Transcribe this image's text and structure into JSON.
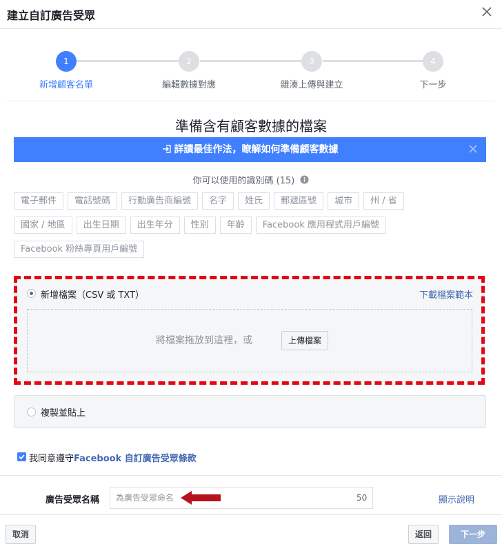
{
  "dialog": {
    "title": "建立自訂廣告受眾"
  },
  "stepper": {
    "steps": [
      {
        "number": "1",
        "label": "新增顧客名單",
        "active": true
      },
      {
        "number": "2",
        "label": "編輯數據對應",
        "active": false
      },
      {
        "number": "3",
        "label": "雜湊上傳與建立",
        "active": false
      },
      {
        "number": "4",
        "label": "下一步",
        "active": false
      }
    ]
  },
  "main": {
    "heading": "準備含有顧客數據的檔案",
    "banner_text": "詳讀最佳作法，瞭解如何準備顧客數據",
    "identifiers_title": "你可以使用的識別碼 (15)",
    "identifiers": [
      "電子郵件",
      "電話號碼",
      "行動廣告商編號",
      "名字",
      "姓氏",
      "郵遞區號",
      "城市",
      "州 / 省",
      "國家 / 地區",
      "出生日期",
      "出生年分",
      "性別",
      "年齡",
      "Facebook 應用程式用戶編號",
      "Facebook 粉絲專頁用戶編號"
    ]
  },
  "upload_option": {
    "label": "新增檔案（CSV 或 TXT）",
    "download_link": "下載檔案範本",
    "drop_text": "將檔案拖放到這裡，或",
    "upload_button": "上傳檔案",
    "selected": true
  },
  "paste_option": {
    "label": "複製並貼上",
    "selected": false
  },
  "terms": {
    "prefix": "我同意遵守",
    "link": "Facebook 自訂廣告受眾條款",
    "checked": true
  },
  "audience_name": {
    "label": "廣告受眾名稱",
    "placeholder": "為廣告受眾命名",
    "remaining": "50",
    "help_link": "顯示說明"
  },
  "footer": {
    "cancel": "取消",
    "back": "返回",
    "next": "下一步"
  },
  "colors": {
    "accent": "#4080ff",
    "highlight_dash": "#e30613",
    "arrow": "#b8121c",
    "next_disabled": "#9cb4d8"
  }
}
